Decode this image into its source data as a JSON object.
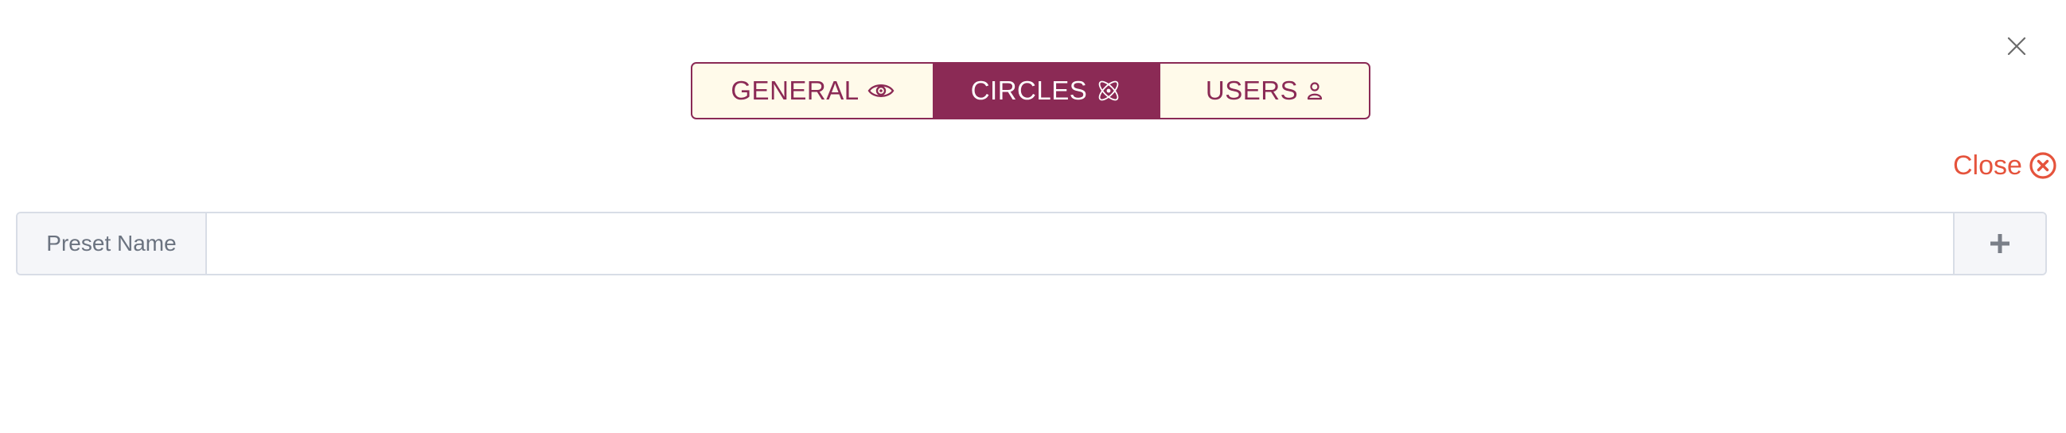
{
  "colors": {
    "accent": "#8b2a55",
    "tab_background": "#fffaea",
    "close_red": "#e5533c",
    "border": "#d8dde6",
    "addon_background": "#f5f6f9",
    "muted_text": "#6b7380"
  },
  "tabs": [
    {
      "label": "GENERAL",
      "icon": "eye-icon",
      "active": false
    },
    {
      "label": "CIRCLES",
      "icon": "atom-icon",
      "active": true
    },
    {
      "label": "USERS",
      "icon": "user-icon",
      "active": false
    }
  ],
  "top_close": {
    "icon": "close-icon"
  },
  "close_link": {
    "label": "Close",
    "icon": "circle-x-icon"
  },
  "preset": {
    "label": "Preset Name",
    "value": "",
    "placeholder": "",
    "add_icon": "plus-icon"
  }
}
